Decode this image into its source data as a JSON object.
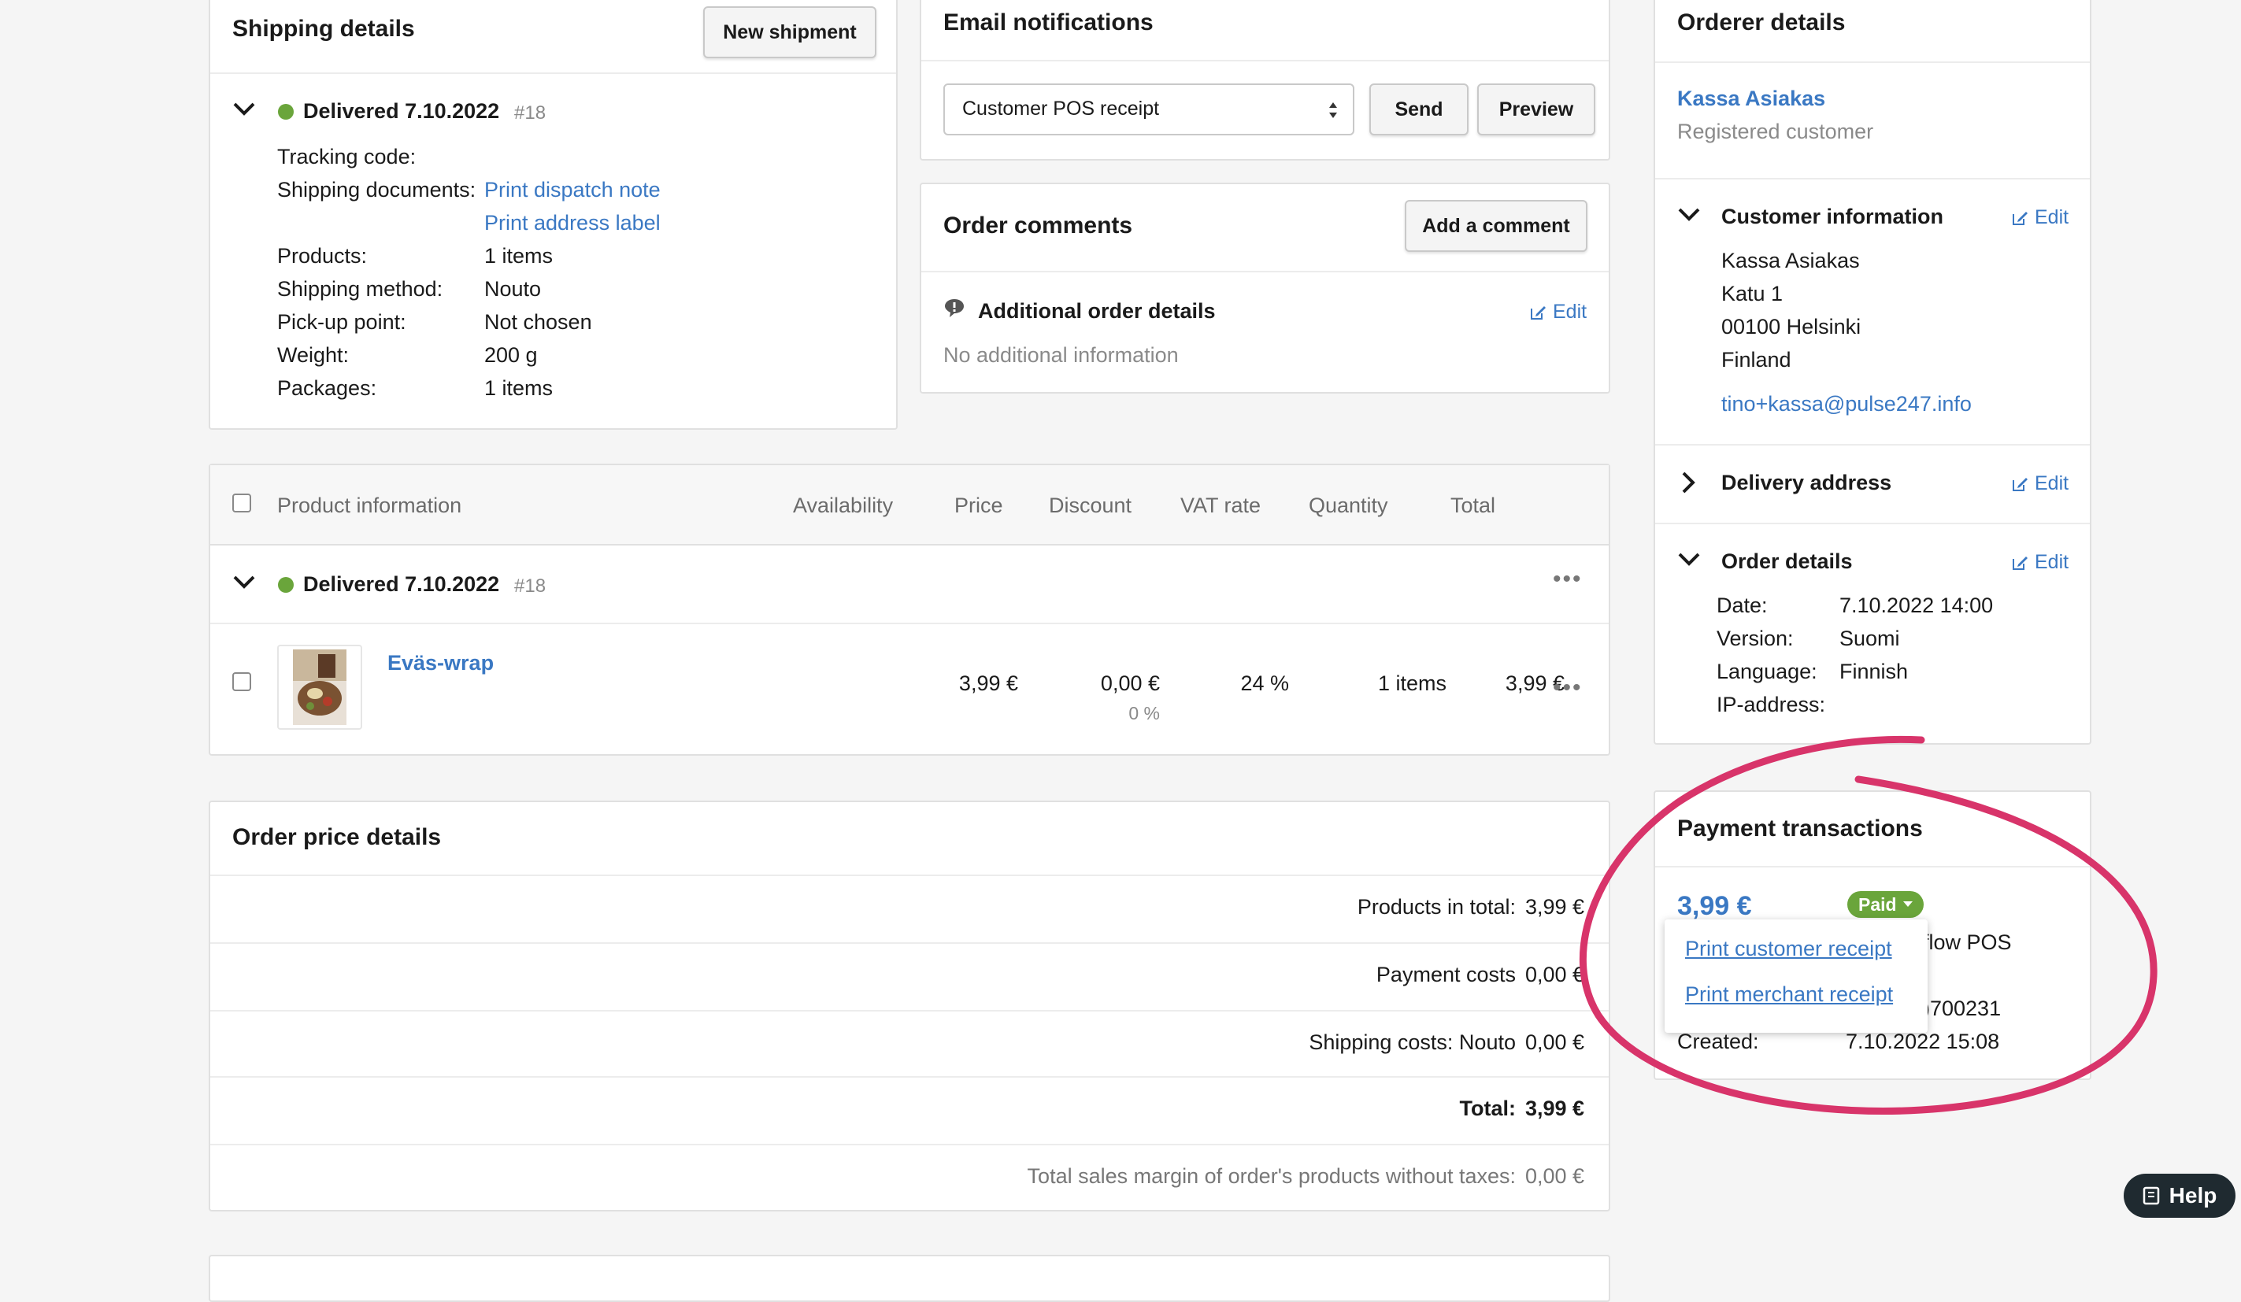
{
  "shipping": {
    "title": "Shipping details",
    "new_shipment": "New shipment",
    "status": "Delivered 7.10.2022",
    "number": "#18",
    "rows": [
      {
        "label": "Tracking code:",
        "value": ""
      },
      {
        "label": "Shipping documents:",
        "value": "Print dispatch note"
      },
      {
        "label": "",
        "value": "Print address label"
      },
      {
        "label": "Products:",
        "value": "1 items"
      },
      {
        "label": "Shipping method:",
        "value": "Nouto"
      },
      {
        "label": "Pick-up point:",
        "value": "Not chosen"
      },
      {
        "label": "Weight:",
        "value": "200 g"
      },
      {
        "label": "Packages:",
        "value": "1 items"
      }
    ]
  },
  "email": {
    "title": "Email notifications",
    "selected": "Customer POS receipt",
    "send": "Send",
    "preview": "Preview"
  },
  "comments": {
    "title": "Order comments",
    "add": "Add a comment",
    "additional_title": "Additional order details",
    "edit": "Edit",
    "empty": "No additional information"
  },
  "orderer": {
    "title": "Orderer details",
    "name": "Kassa Asiakas",
    "type": "Registered customer",
    "customer_info": "Customer information",
    "edit": "Edit",
    "address_lines": [
      "Kassa Asiakas",
      "Katu 1",
      "00100 Helsinki",
      "Finland"
    ],
    "email": "tino+kassa@pulse247.info",
    "delivery_address": "Delivery address",
    "order_details": "Order details",
    "details": [
      {
        "label": "Date:",
        "value": "7.10.2022 14:00"
      },
      {
        "label": "Version:",
        "value": "Suomi"
      },
      {
        "label": "Language:",
        "value": "Finnish"
      },
      {
        "label": "IP-address:",
        "value": ""
      }
    ]
  },
  "products": {
    "headers": [
      "Product information",
      "Availability",
      "Price",
      "Discount",
      "VAT rate",
      "Quantity",
      "Total"
    ],
    "group_status": "Delivered 7.10.2022",
    "group_number": "#18",
    "item": {
      "name": "Eväs-wrap",
      "price": "3,99 €",
      "discount": "0,00 €",
      "discount_pct": "0 %",
      "vat": "24 %",
      "quantity": "1 items",
      "total": "3,99 €"
    }
  },
  "price": {
    "title": "Order price details",
    "rows": [
      {
        "label": "Products in total:",
        "value": "3,99 €"
      },
      {
        "label": "Payment costs",
        "value": "0,00 €"
      },
      {
        "label": "Shipping costs: Nouto",
        "value": "0,00 €"
      },
      {
        "label": "Total:",
        "value": "3,99 €"
      },
      {
        "label": "Total sales margin of order's products without taxes:",
        "value": "0,00 €"
      }
    ]
  },
  "payment": {
    "title": "Payment transactions",
    "amount": "3,99 €",
    "badge": "Paid",
    "method_partial": "flow POS",
    "id_partial": ")700231",
    "created_label": "Created:",
    "created_value": "7.10.2022 15:08",
    "menu": [
      "Print customer receipt",
      "Print merchant receipt"
    ]
  },
  "help": {
    "label": "Help"
  },
  "colors": {
    "link": "#3a78c3",
    "status_green": "#6aa53b",
    "annotation": "#d8346a"
  }
}
